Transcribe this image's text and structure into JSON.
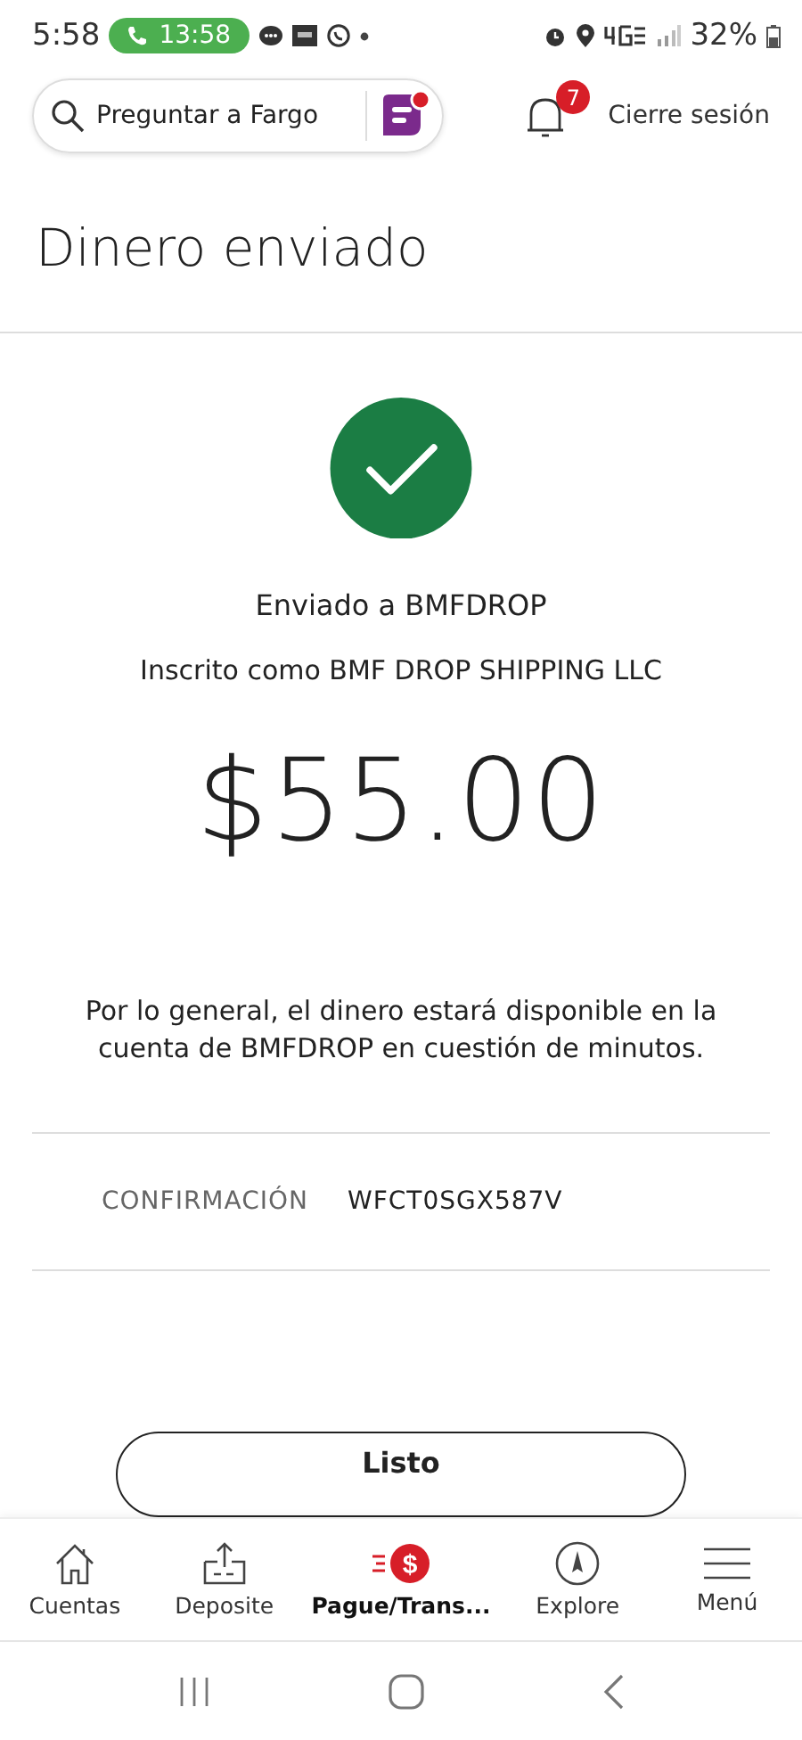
{
  "status_bar": {
    "time": "5:58",
    "call_time": "13:58",
    "battery": "32%"
  },
  "header": {
    "search": {
      "placeholder": "Preguntar a Fargo"
    },
    "notifications": {
      "count": "7"
    },
    "logout": "Cierre sesión"
  },
  "title": "Dinero enviado",
  "recipient": "Enviado a BMFDROP",
  "enrolled_as": "Inscrito como BMF DROP SHIPPING LLC",
  "amount": "$55.00",
  "note": "Por lo general, el dinero estará disponible en la cuenta de BMFDROP en cuestión de minutos.",
  "confirmation": {
    "label": "CONFIRMACIÓN",
    "value": "WFCT0SGX587V"
  },
  "done_button": "Listo",
  "bottom_nav": [
    {
      "kind": "home",
      "label": "Cuentas",
      "selected": false
    },
    {
      "kind": "deposit",
      "label": "Deposite",
      "selected": false
    },
    {
      "kind": "pay",
      "label": "Pague/Trans...",
      "icon_text": "$",
      "selected": true
    },
    {
      "kind": "explore",
      "label": "Explore",
      "selected": false
    },
    {
      "kind": "menu",
      "label": "Menú",
      "selected": false
    }
  ]
}
